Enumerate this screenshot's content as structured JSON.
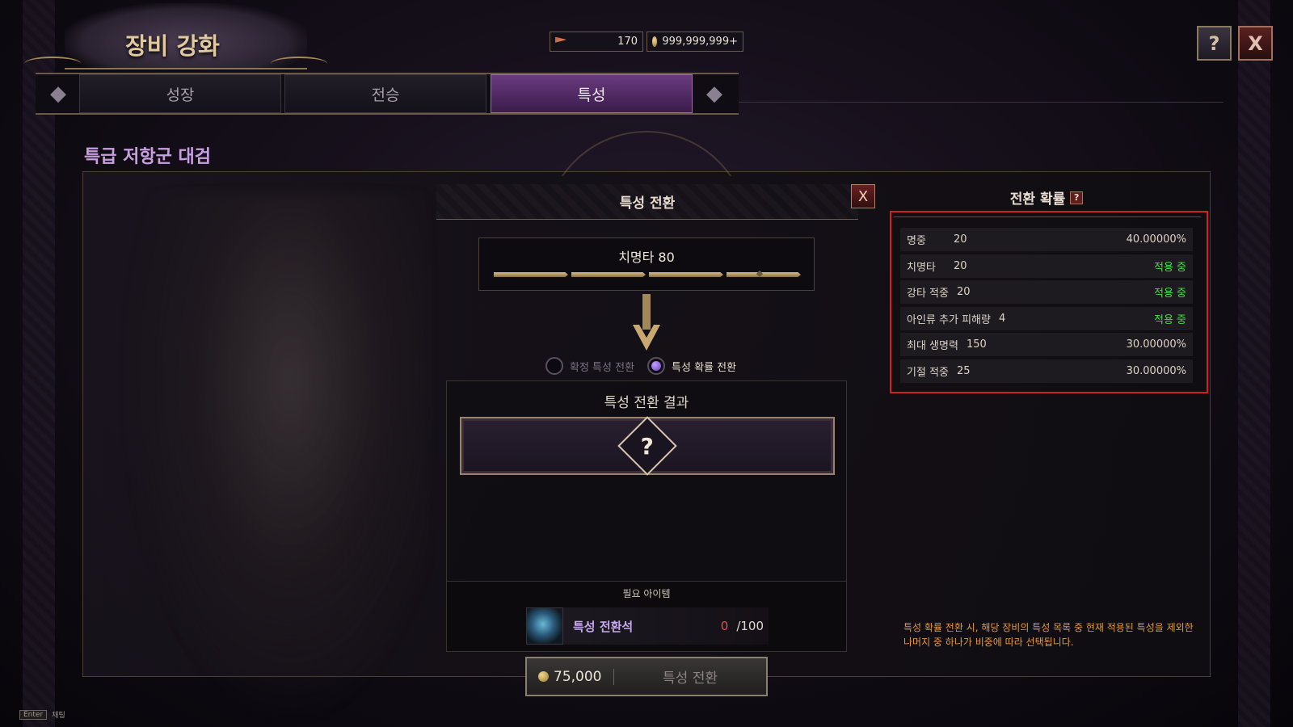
{
  "header": {
    "title": "장비 강화",
    "currency1_value": "170",
    "currency1_icon": "flag-icon",
    "currency2_value": "999,999,999+",
    "currency2_icon": "coin-icon",
    "help_icon": "?",
    "close_icon": "X"
  },
  "tabs": [
    {
      "label": "성장",
      "active": false
    },
    {
      "label": "전승",
      "active": false
    },
    {
      "label": "특성",
      "active": true
    }
  ],
  "item_name": "특급 저항군 대검",
  "trait_change": {
    "title": "특성 전환",
    "close_icon": "X",
    "current_trait": "치명타 80",
    "modes": [
      {
        "label": "확정 특성 전환",
        "selected": false
      },
      {
        "label": "특성 확률 전환",
        "selected": true
      }
    ],
    "result_title": "특성 전환 결과",
    "result_placeholder": "?"
  },
  "required": {
    "title": "필요 아이템",
    "item_name": "특성 전환석",
    "have": "0",
    "need": "/100"
  },
  "action": {
    "cost": "75,000",
    "label": "특성 전환"
  },
  "probability": {
    "title": "전환 확률",
    "help": "?",
    "rows": [
      {
        "name": "명중",
        "value": "20",
        "rate": "40.00000%",
        "applied": false
      },
      {
        "name": "치명타",
        "value": "20",
        "rate": "적용 중",
        "applied": true
      },
      {
        "name": "강타 적중",
        "value": "20",
        "rate": "적용 중",
        "applied": true
      },
      {
        "name": "아인류 추가 피해량",
        "value": "4",
        "rate": "적용 중",
        "applied": true
      },
      {
        "name": "최대 생명력",
        "value": "150",
        "rate": "30.00000%",
        "applied": false
      },
      {
        "name": "기절 적중",
        "value": "25",
        "rate": "30.00000%",
        "applied": false
      }
    ],
    "note": "특성 확률 전환 시, 해당 장비의 특성 목록 중 현재 적용된 특성을 제외한 나머지 중 하나가 비중에 따라 선택됩니다."
  },
  "footer": {
    "key": "Enter",
    "label": "채팅"
  },
  "colors": {
    "accent_purple": "#6a3a80",
    "applied_green": "#40e040",
    "highlight_red": "#d02020",
    "note_orange": "#e09a40"
  }
}
